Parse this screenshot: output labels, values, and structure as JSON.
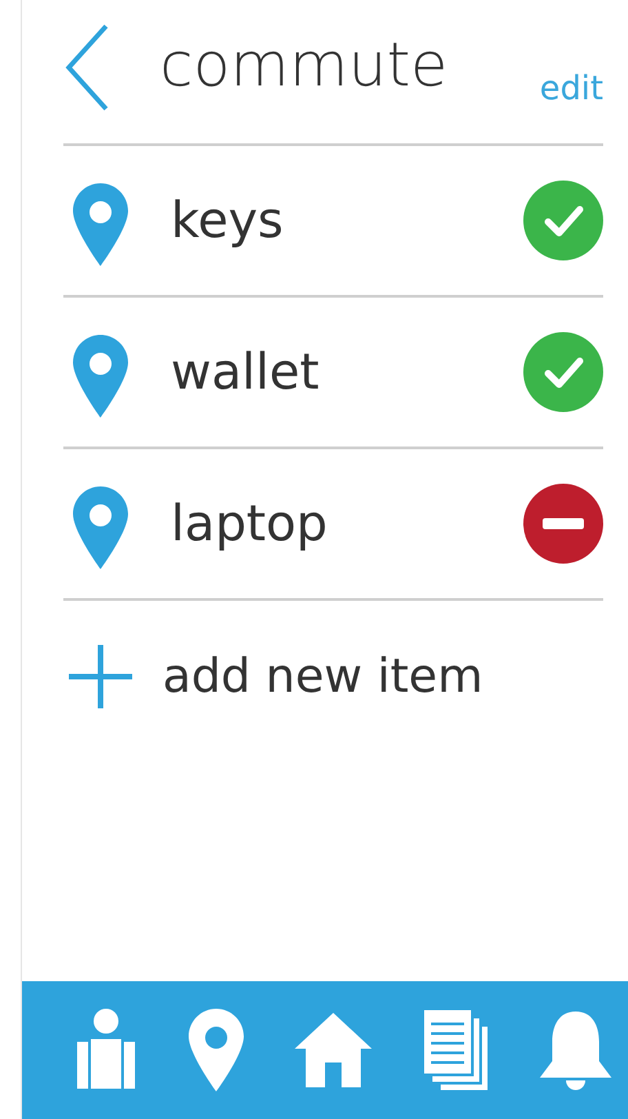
{
  "header": {
    "title": "commute",
    "edit": "edit"
  },
  "items": [
    {
      "name": "keys",
      "checked": true
    },
    {
      "name": "wallet",
      "checked": true
    },
    {
      "name": "laptop",
      "checked": false
    }
  ],
  "add_item": {
    "label": "add new item"
  }
}
